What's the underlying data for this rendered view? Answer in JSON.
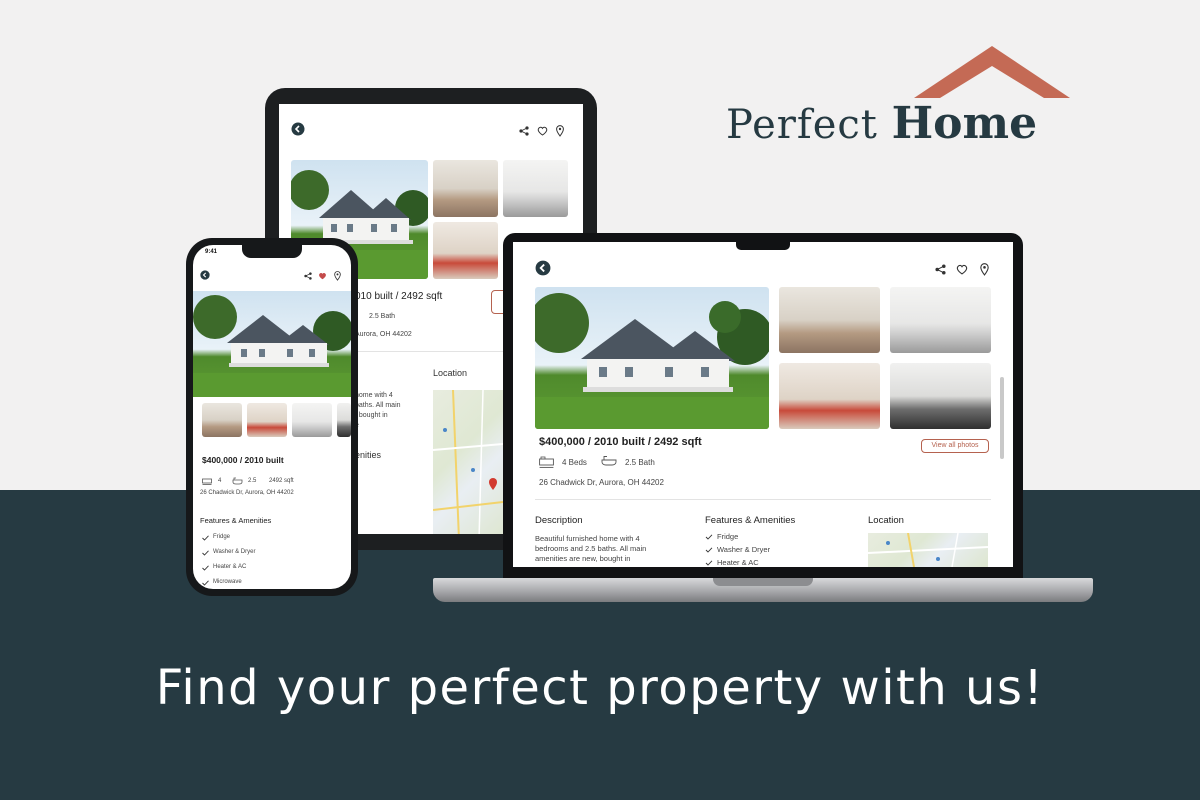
{
  "brand": {
    "name_light": "Perfect",
    "name_bold": "Home",
    "roof_color": "#c46a55",
    "text_color": "#263a42"
  },
  "tagline": "Find your perfect property with us!",
  "colors": {
    "dark_band": "#263a42",
    "light_bg": "#f2f1f1",
    "accent": "#b5624f",
    "heart_active": "#c44b4b"
  },
  "icons": [
    "back-arrow-icon",
    "share-icon",
    "heart-icon",
    "location-pin-icon",
    "bed-icon",
    "bath-icon",
    "check-icon"
  ],
  "laptop": {
    "price_line": "$400,000 / 2010 built /  2492 sqft",
    "beds": "4 Beds",
    "baths": "2.5 Bath",
    "address": "26 Chadwick Dr, Aurora, OH 44202",
    "view_all": "View all photos",
    "description_heading": "Description",
    "description_lines": [
      "Beautiful furnished home with 4",
      "bedrooms and 2.5 baths. All main",
      "amenities are new, bought in"
    ],
    "features_heading": "Features & Amenities",
    "features": [
      "Fridge",
      "Washer & Dryer",
      "Heater & AC"
    ],
    "location_heading": "Location"
  },
  "tablet": {
    "price_line": "010 built /  2492 sqft",
    "baths": "2.5 Bath",
    "address": "Aurora, OH 44202",
    "location_heading": "Location",
    "desc_lines": [
      "home with 4",
      "baths. All main",
      ", bought in",
      "e"
    ],
    "amenities_fragment": "enities"
  },
  "phone": {
    "time": "9:41",
    "price_line": "$400,000 / 2010 built",
    "beds": "4",
    "baths": "2.5",
    "sqft": "2492 sqft",
    "address": "26 Chadwick Dr, Aurora, OH 44202",
    "features_heading": "Features & Amenities",
    "features": [
      "Fridge",
      "Washer & Dryer",
      "Heater & AC",
      "Microwave"
    ]
  }
}
